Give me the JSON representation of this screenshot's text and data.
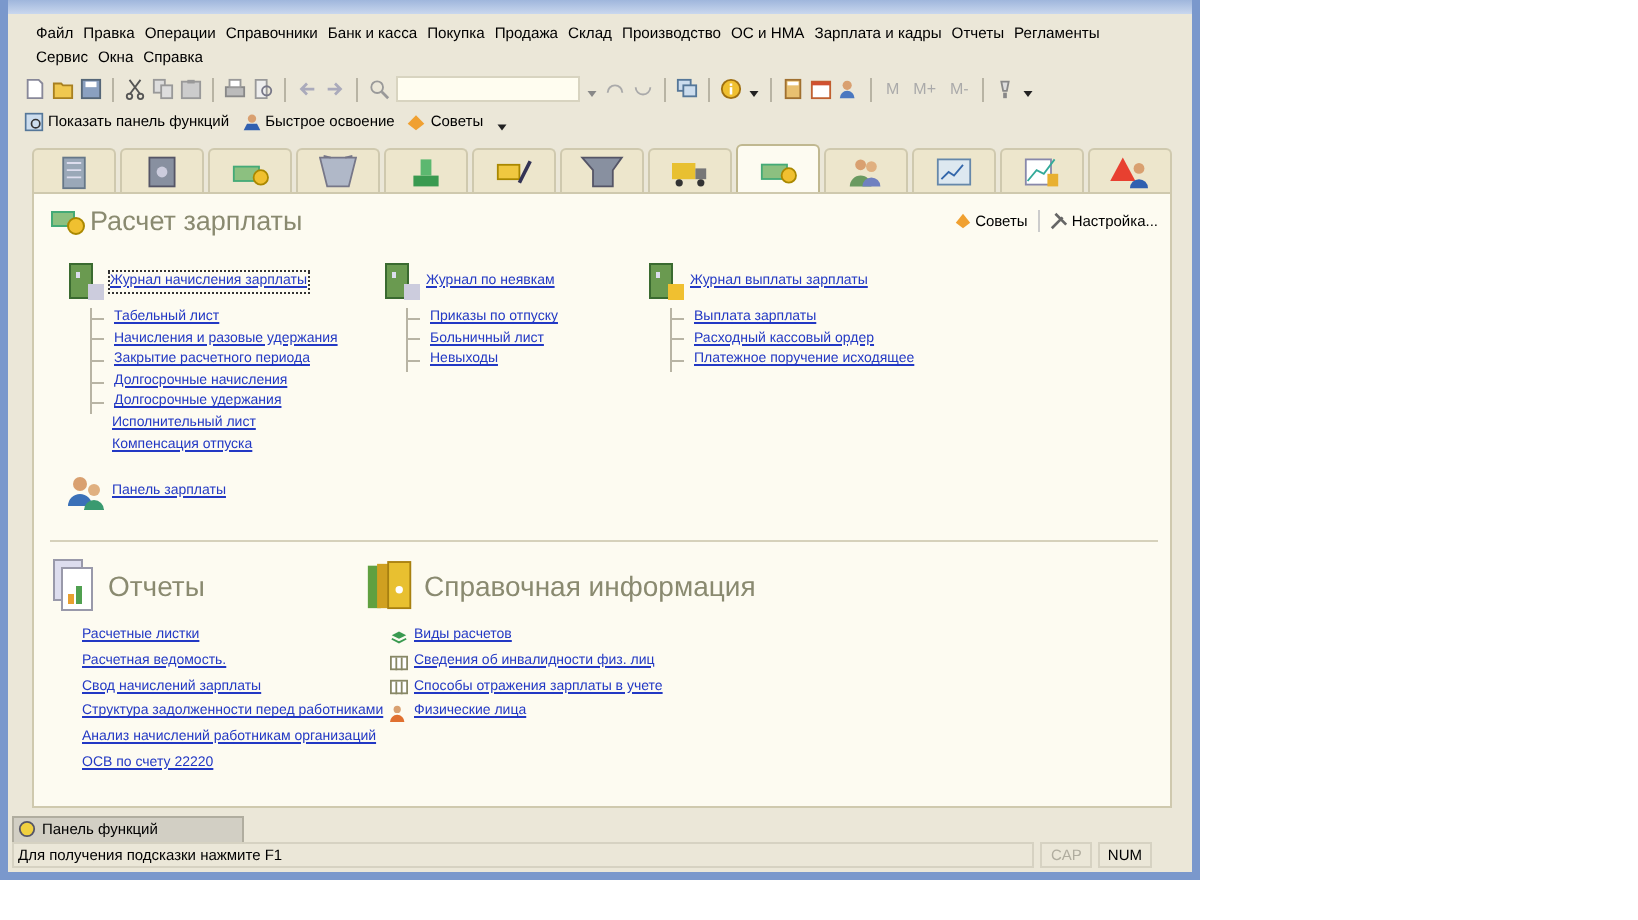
{
  "menu": {
    "rows": [
      [
        {
          "label": "Файл"
        },
        {
          "label": "Правка"
        },
        {
          "label": "Операции"
        },
        {
          "label": "Справочники"
        },
        {
          "label": "Банк и касса"
        },
        {
          "label": "Покупка"
        },
        {
          "label": "Продажа"
        },
        {
          "label": "Склад"
        },
        {
          "label": "Производство"
        },
        {
          "label": "ОС и НМА"
        },
        {
          "label": "Зарплата и кадры"
        },
        {
          "label": "Отчеты"
        },
        {
          "label": "Регламенты"
        }
      ],
      [
        {
          "label": "Сервис"
        },
        {
          "label": "Окна"
        },
        {
          "label": "Справка"
        }
      ]
    ]
  },
  "toolbar": {
    "memory_buttons": [
      {
        "label": "M",
        "disabled": true
      },
      {
        "label": "M+",
        "disabled": true
      },
      {
        "label": "M-",
        "disabled": true
      }
    ]
  },
  "quick_bar": [
    {
      "label": "Показать панель функций"
    },
    {
      "label": "Быстрое освоение"
    },
    {
      "label": "Советы"
    }
  ],
  "tabs": [
    {
      "selected": false
    },
    {
      "selected": false
    },
    {
      "selected": false
    },
    {
      "selected": false
    },
    {
      "selected": false
    },
    {
      "selected": false
    },
    {
      "selected": false
    },
    {
      "selected": false
    },
    {
      "selected": true
    },
    {
      "selected": false
    },
    {
      "selected": false
    },
    {
      "selected": false
    },
    {
      "selected": false
    }
  ],
  "panel": {
    "title": "Расчет зарплаты",
    "actions": [
      "Советы",
      "Настройка..."
    ],
    "groups": [
      {
        "title": "Журнал начисления зарплаты",
        "focused": true,
        "items": [
          {
            "label": "Табельный лист",
            "branch": true
          },
          {
            "label": "Начисления и разовые удержания",
            "branch": true
          },
          {
            "label": "Закрытие расчетного периода",
            "branch": true
          },
          {
            "label": "Долгосрочные начисления",
            "branch": true
          },
          {
            "label": "Долгосрочные удержания",
            "branch": true
          },
          {
            "label": "Исполнительный лист",
            "branch": false
          },
          {
            "label": "Компенсация отпуска",
            "branch": false
          }
        ]
      },
      {
        "title": "Журнал по неявкам",
        "focused": false,
        "items": [
          {
            "label": "Приказы по отпуску",
            "branch": true
          },
          {
            "label": "Больничный лист",
            "branch": true
          },
          {
            "label": "Невыходы",
            "branch": true
          }
        ]
      },
      {
        "title": "Журнал выплаты зарплаты",
        "focused": false,
        "items": [
          {
            "label": "Выплата зарплаты",
            "branch": true
          },
          {
            "label": "Расходный кассовый ордер",
            "branch": true
          },
          {
            "label": "Платежное поручение исходящее",
            "branch": true
          }
        ]
      }
    ],
    "extra_link": "Панель зарплаты",
    "reports": {
      "title": "Отчеты",
      "items": [
        "Расчетные листки",
        "Расчетная ведомость.",
        "Свод начислений зарплаты",
        "Структура задолженности перед работниками",
        "Анализ начислений работникам организаций",
        "ОСВ по счету 22220"
      ]
    },
    "reference": {
      "title": "Справочная информация",
      "items": [
        {
          "label": "Виды расчетов",
          "kind": "stack"
        },
        {
          "label": "Сведения об инвалидности физ. лиц",
          "kind": "table"
        },
        {
          "label": "Способы отражения зарплаты в учете",
          "kind": "table"
        },
        {
          "label": "Физические лица",
          "kind": "people"
        }
      ]
    }
  },
  "function_panel_tab": "Панель функций",
  "status_bar": {
    "hint": "Для получения подсказки нажмите F1",
    "indicators": [
      {
        "label": "CAP",
        "on": false
      },
      {
        "label": "NUM",
        "on": true
      }
    ]
  }
}
